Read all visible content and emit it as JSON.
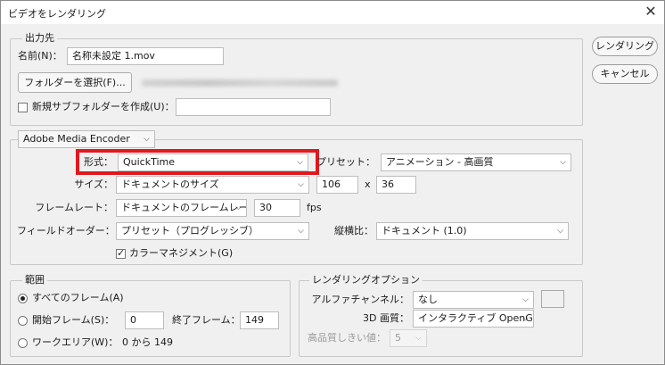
{
  "window": {
    "title": "ビデオをレンダリング"
  },
  "buttons": {
    "render": "レンダリング",
    "cancel": "キャンセル"
  },
  "output": {
    "legend": "出力先",
    "name_label": "名前(N)：",
    "name_value": "名称未設定 1.mov",
    "select_folder": "フォルダーを選択(F)...",
    "new_subfolder_label": "新規サブフォルダーを作成(U)：",
    "new_subfolder_value": ""
  },
  "encoder": {
    "selected": "Adobe Media Encoder"
  },
  "format": {
    "label": "形式：",
    "value": "QuickTime",
    "preset_label": "プリセット：",
    "preset_value": "アニメーション - 高画質",
    "size_label": "サイズ：",
    "size_value": "ドキュメントのサイズ",
    "width": "106",
    "x_sep": "x",
    "height": "36",
    "framerate_label": "フレームレート：",
    "framerate_value": "ドキュメントのフレームレート",
    "fps_value": "30",
    "fps_unit": "fps",
    "field_order_label": "フィールドオーダー：",
    "field_order_value": "プリセット（プログレッシブ）",
    "aspect_label": "縦横比：",
    "aspect_value": "ドキュメント (1.0)",
    "color_mgmt_label": "カラーマネジメント(G)",
    "color_mgmt_checked": true
  },
  "range": {
    "legend": "範囲",
    "all_frames": "すべてのフレーム(A)",
    "start_frame_label": "開始フレーム(S)：",
    "start_frame_value": "0",
    "end_frame_label": "終了フレーム：",
    "end_frame_value": "149",
    "work_area_label": "ワークエリア(W)：",
    "work_area_value": "0 から 149",
    "selected": "all_frames"
  },
  "render_options": {
    "legend": "レンダリングオプション",
    "alpha_label": "アルファチャンネル：",
    "alpha_value": "なし",
    "quality_label": "3D 画質：",
    "quality_value": "インタラクティブ OpenGL",
    "threshold_label": "高品質しきい値：",
    "threshold_value": "5"
  },
  "colors": {
    "highlight": "#e0191e",
    "background": "#f0f0f0"
  }
}
